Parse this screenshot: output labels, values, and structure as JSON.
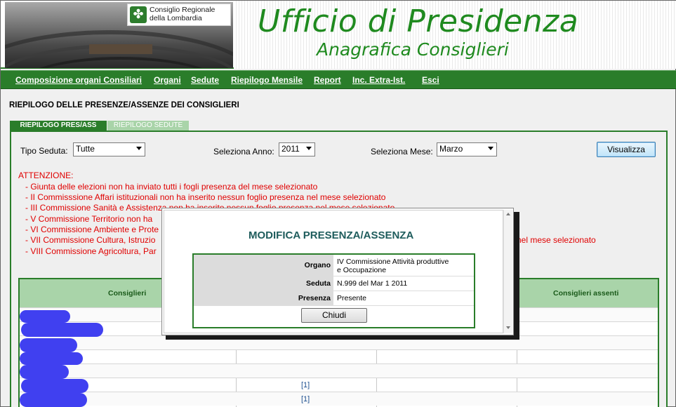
{
  "header": {
    "logo_line1": "Consiglio Regionale",
    "logo_line2": "della Lombardia",
    "title": "Ufficio di Presidenza",
    "subtitle": "Anagrafica Consiglieri"
  },
  "nav": [
    "Composizione organi Consiliari",
    "Organi",
    "Sedute",
    "Riepilogo Mensile",
    "Report",
    "Inc. Extra-Ist.",
    "Esci"
  ],
  "page_heading": "RIEPILOGO DELLE PRESENZE/ASSENZE DEI CONSIGLIERI",
  "tabs": {
    "active": "RIEPILOGO PRES/ASS",
    "inactive": "RIEPILOGO SEDUTE"
  },
  "filters": {
    "tipo_label": "Tipo Seduta:",
    "tipo_value": "Tutte",
    "anno_label": "Seleziona Anno:",
    "anno_value": "2011",
    "mese_label": "Seleziona Mese:",
    "mese_value": "Marzo",
    "button": "Visualizza"
  },
  "warnings": {
    "title": "ATTENZIONE:",
    "lines": [
      "- Giunta delle elezioni non ha inviato tutti i fogli presenza del mese selezionato",
      "- II Commisssione Affari istituzionali non ha inserito nessun foglio presenza nel mese selezionato",
      "- III Commissione Sanità e Assistenza non ha inserito nessun foglio presenza nel mese selezionato",
      "- V Commissione Territorio non ha",
      "- VI Commissione Ambiente e Prote",
      "- VII Commissione Cultura, Istruzio",
      "- VIII Commissione Agricoltura, Par"
    ],
    "line6_tail": "nel mese selezionato"
  },
  "table": {
    "col_consiglieri": "Consiglieri",
    "col_assenti": "Consiglieri assenti",
    "links": [
      "[1]",
      "[1]"
    ]
  },
  "modal": {
    "title": "MODIFICA PRESENZA/ASSENZA",
    "organo_label": "Organo",
    "organo_value_1": "IV Commissione Attività produttive",
    "organo_value_2": "e Occupazione",
    "seduta_label": "Seduta",
    "seduta_value": "N.999 del Mar 1 2011",
    "presenza_label": "Presenza",
    "presenza_value": "Presente",
    "close_button": "Chiudi"
  }
}
